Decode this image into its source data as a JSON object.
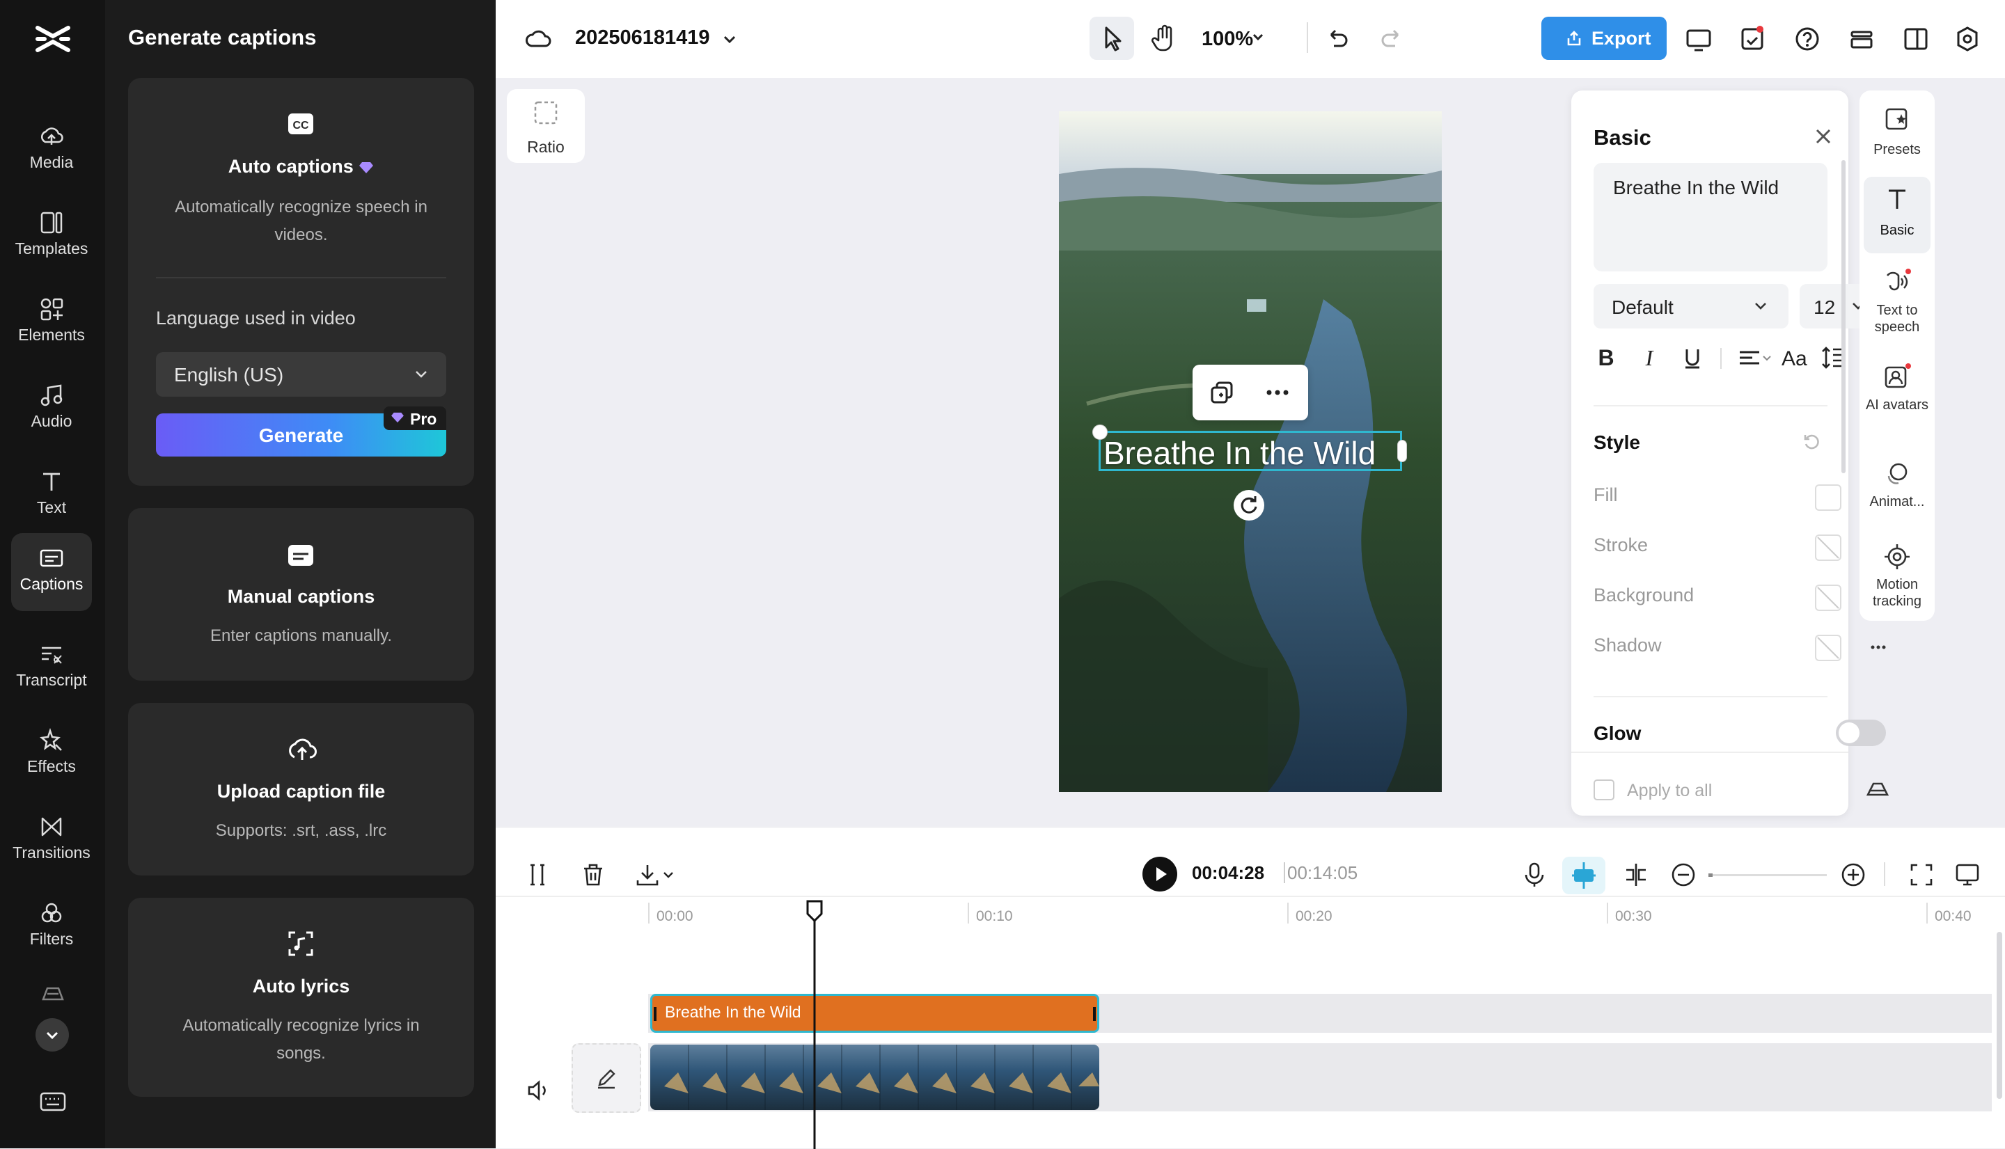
{
  "rail": {
    "items": [
      {
        "label": "Media",
        "icon": "cloud-upload-icon"
      },
      {
        "label": "Templates",
        "icon": "templates-icon"
      },
      {
        "label": "Elements",
        "icon": "elements-icon"
      },
      {
        "label": "Audio",
        "icon": "music-note-icon"
      },
      {
        "label": "Text",
        "icon": "text-icon"
      },
      {
        "label": "Captions",
        "icon": "captions-icon"
      },
      {
        "label": "Transcript",
        "icon": "transcript-icon"
      },
      {
        "label": "Effects",
        "icon": "effects-icon"
      },
      {
        "label": "Transitions",
        "icon": "transitions-icon"
      },
      {
        "label": "Filters",
        "icon": "filters-icon"
      }
    ],
    "active": "Captions"
  },
  "panel": {
    "title": "Generate captions",
    "auto_captions": {
      "title": "Auto captions",
      "desc": "Automatically recognize speech in videos.",
      "language_label": "Language used in video",
      "language_value": "English (US)",
      "generate_label": "Generate",
      "pro_badge": "Pro"
    },
    "manual": {
      "title": "Manual captions",
      "desc": "Enter captions manually."
    },
    "upload": {
      "title": "Upload caption file",
      "desc": "Supports: .srt, .ass, .lrc"
    },
    "lyrics": {
      "title": "Auto lyrics",
      "desc": "Automatically recognize lyrics in songs."
    }
  },
  "topbar": {
    "project_name": "202506181419",
    "zoom": "100%",
    "export_label": "Export"
  },
  "stage": {
    "ratio_label": "Ratio",
    "caption_text": "Breathe In the Wild"
  },
  "props": {
    "title": "Basic",
    "text_value": "Breathe In the Wild",
    "font": "Default",
    "font_size": "12",
    "style_label": "Style",
    "fill_label": "Fill",
    "stroke_label": "Stroke",
    "background_label": "Background",
    "shadow_label": "Shadow",
    "glow_label": "Glow",
    "apply_all_label": "Apply to all",
    "glow_on": false
  },
  "side_tabs": [
    {
      "label": "Presets",
      "icon": "presets-icon"
    },
    {
      "label": "Basic",
      "icon": "text-icon"
    },
    {
      "label": "Text to speech",
      "icon": "text-to-speech-icon"
    },
    {
      "label": "AI avatars",
      "icon": "ai-avatar-icon"
    },
    {
      "label": "Animat...",
      "icon": "animation-icon"
    },
    {
      "label": "Motion tracking",
      "icon": "motion-tracking-icon"
    }
  ],
  "timeline": {
    "current_time": "00:04:28",
    "total_time": "00:14:05",
    "ruler": [
      "00:00",
      "00:10",
      "00:20",
      "00:30",
      "00:40"
    ],
    "caption_clip_text": "Breathe In the Wild",
    "colors": {
      "caption_clip": "#e07020",
      "accent": "#2aa6d6"
    }
  },
  "colors": {
    "export_button": "#2f8fe8",
    "generate_gradient_start": "#6a5cf6",
    "generate_gradient_end": "#1ec7d8"
  }
}
